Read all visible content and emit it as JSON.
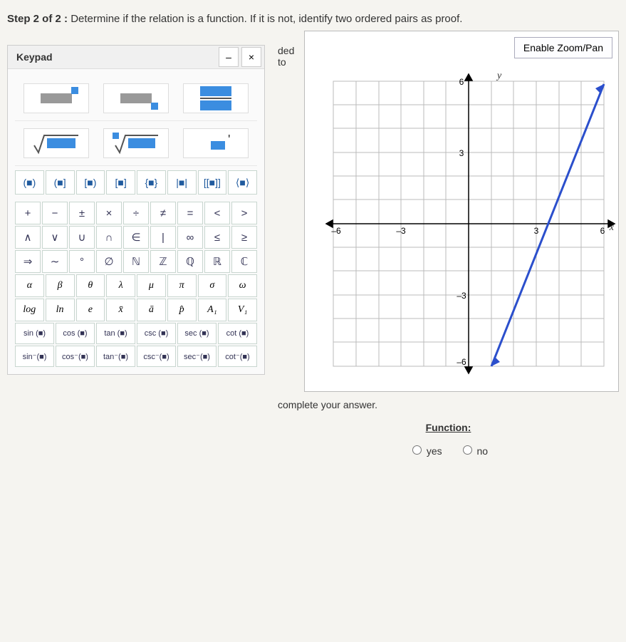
{
  "step": {
    "prefix": "Step 2 of 2 :",
    "text": "Determine if the relation is a function. If it is not, identify two ordered pairs as proof."
  },
  "graph": {
    "zoom_btn": "Enable Zoom/Pan",
    "y_label": "y",
    "x_label": "x",
    "ticks": {
      "neg6": "–6",
      "neg3": "–3",
      "pos3": "3",
      "pos6": "6"
    }
  },
  "keypad": {
    "title": "Keypad",
    "min": "–",
    "close": "×",
    "brackets": [
      "(■)",
      "(■]",
      "[■)",
      "[■]",
      "{■}",
      "|■|",
      "[[■]]",
      "⟨■⟩"
    ],
    "row1": [
      "+",
      "−",
      "±",
      "×",
      "÷",
      "≠",
      "=",
      "<",
      ">"
    ],
    "row2": [
      "∧",
      "∨",
      "∪",
      "∩",
      "∈",
      "|",
      "∞",
      "≤",
      "≥"
    ],
    "row3": [
      "⇒",
      "∼",
      "°",
      "∅",
      "ℕ",
      "ℤ",
      "ℚ",
      "ℝ",
      "ℂ"
    ],
    "row_greek": [
      "α",
      "β",
      "θ",
      "λ",
      "μ",
      "π",
      "σ",
      "ω"
    ],
    "row_misc": [
      "log",
      "ln",
      "e",
      "x̄",
      "ā",
      "p̂",
      "A₁",
      "V₁"
    ],
    "trig1": [
      "sin (■)",
      "cos (■)",
      "tan (■)",
      "csc (■)",
      "sec (■)",
      "cot (■)"
    ],
    "trig2": [
      "sin⁻(■)",
      "cos⁻(■)",
      "tan⁻(■)",
      "csc⁻(■)",
      "sec⁻(■)",
      "cot⁻(■)"
    ]
  },
  "answer": {
    "hint": "ded to complete your answer.",
    "label": "Function:",
    "yes": "yes",
    "no": "no"
  },
  "chart_data": {
    "type": "line",
    "title": "",
    "x_range": [
      -6,
      6
    ],
    "y_range": [
      -6,
      6
    ],
    "grid": true,
    "x_ticks": [
      -6,
      -3,
      3,
      6
    ],
    "y_ticks": [
      -6,
      -3,
      3,
      6
    ],
    "series": [
      {
        "name": "relation-line",
        "x": [
          1,
          6
        ],
        "y": [
          -6,
          5.9
        ],
        "style": "arrowed-line",
        "color": "#2b4fcc"
      }
    ],
    "xlabel": "x",
    "ylabel": "y"
  }
}
